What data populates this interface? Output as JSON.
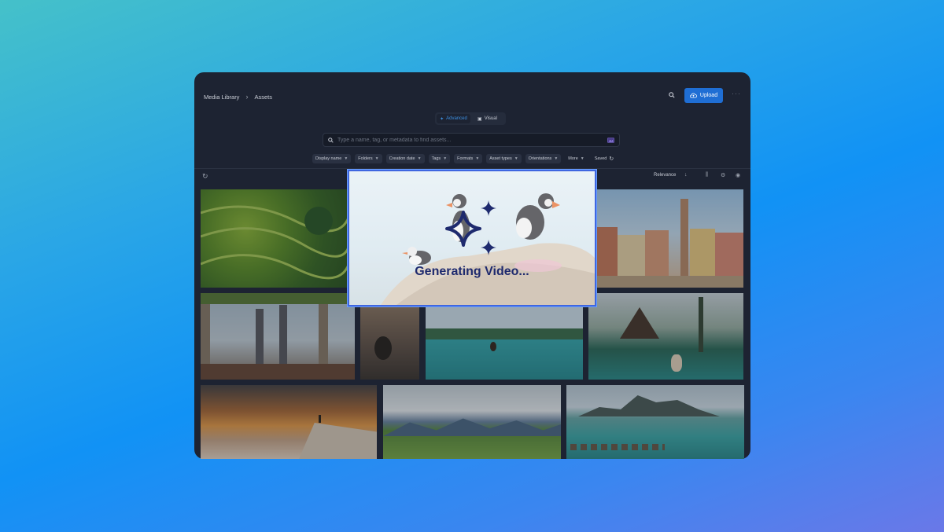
{
  "header": {
    "breadcrumb": [
      "Media Library",
      "Assets"
    ],
    "upload_label": "Upload"
  },
  "search_mode": {
    "options": [
      "Advanced",
      "Visual"
    ],
    "active": "Advanced"
  },
  "search": {
    "placeholder": "Type a name, tag, or metadata to find assets..."
  },
  "filters": [
    "Display name",
    "Folders",
    "Creation date",
    "Tags",
    "Formats",
    "Asset types",
    "Orientations",
    "More"
  ],
  "saved_label": "Saved",
  "sort": {
    "label": "Relevance"
  },
  "overlay": {
    "text": "Generating Video..."
  },
  "icons": {
    "search": "search-icon",
    "upload": "cloud-upload-icon",
    "more": "ellipsis-icon",
    "refresh": "refresh-icon",
    "sort_direction": "arrow-down-icon",
    "columns": "columns-icon",
    "settings": "gear-icon",
    "view": "eye-icon",
    "sparkle": "sparkle-icon"
  },
  "colors": {
    "accent": "#1f6ed4",
    "panel": "#1d2332",
    "overlay_text": "#1e2a6e"
  }
}
